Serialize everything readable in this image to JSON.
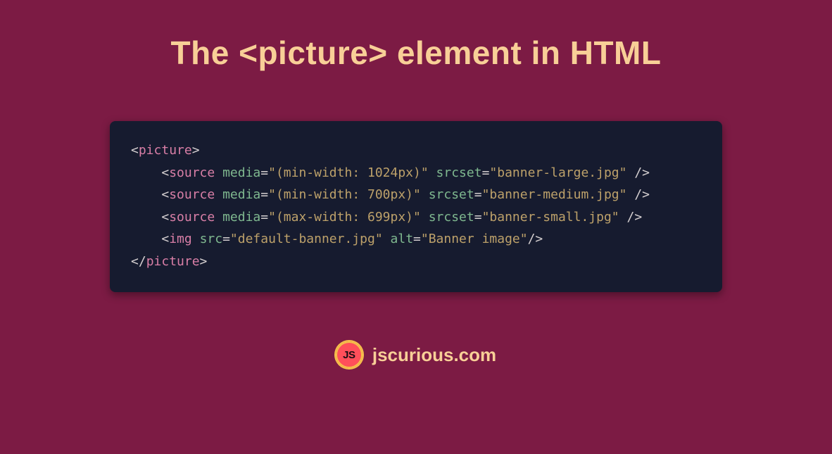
{
  "title": "The <picture> element in HTML",
  "code": {
    "lines": [
      {
        "indent": 0,
        "kind": "open",
        "tag": "picture",
        "attrs": [],
        "selfclose": false
      },
      {
        "indent": 1,
        "kind": "open",
        "tag": "source",
        "attrs": [
          {
            "name": "media",
            "value": "(min-width: 1024px)"
          },
          {
            "name": "srcset",
            "value": "banner-large.jpg"
          }
        ],
        "selfclose": true
      },
      {
        "indent": 1,
        "kind": "open",
        "tag": "source",
        "attrs": [
          {
            "name": "media",
            "value": "(min-width: 700px)"
          },
          {
            "name": "srcset",
            "value": "banner-medium.jpg"
          }
        ],
        "selfclose": true
      },
      {
        "indent": 1,
        "kind": "open",
        "tag": "source",
        "attrs": [
          {
            "name": "media",
            "value": "(max-width: 699px)"
          },
          {
            "name": "srcset",
            "value": "banner-small.jpg"
          }
        ],
        "selfclose": true
      },
      {
        "indent": 1,
        "kind": "open",
        "tag": "img",
        "attrs": [
          {
            "name": "src",
            "value": "default-banner.jpg"
          },
          {
            "name": "alt",
            "value": "Banner image"
          }
        ],
        "selfclose": true
      },
      {
        "indent": 0,
        "kind": "close",
        "tag": "picture",
        "attrs": [],
        "selfclose": false
      }
    ]
  },
  "footer": {
    "logo_text": "JS",
    "site": "jscurious.com"
  }
}
